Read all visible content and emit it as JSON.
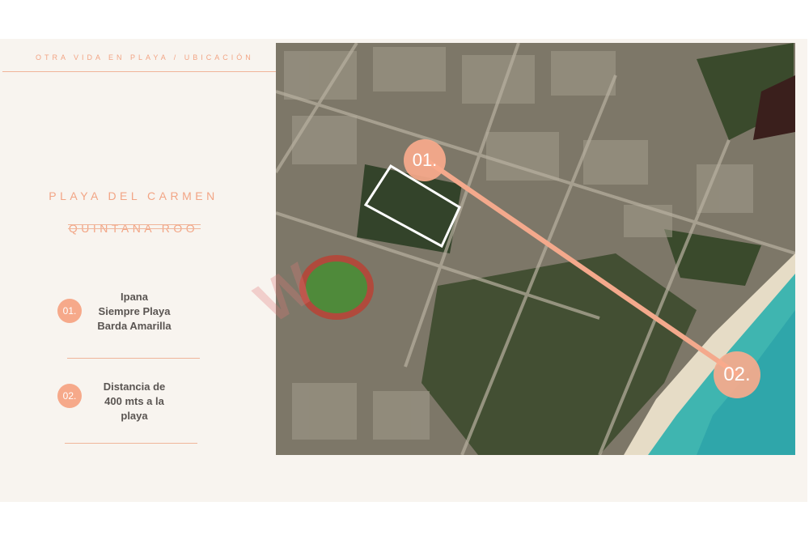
{
  "header": {
    "breadcrumb": "OTRA VIDA EN PLAYA  /  UBICACIÓN"
  },
  "location": {
    "line1": "PLAYA DEL CARMEN",
    "line2": "QUINTANA ROO"
  },
  "items": [
    {
      "number": "01.",
      "lines": [
        "Ipana",
        "Siempre Playa",
        "Barda Amarilla"
      ]
    },
    {
      "number": "02.",
      "lines": [
        "Distancia de",
        "400 mts a la",
        "playa"
      ]
    }
  ],
  "map": {
    "marker_start": "01.",
    "marker_end": "02.",
    "route_color": "#f4a98c",
    "lot_outline_color": "#ffffff",
    "sea_color": "#3fb5b0"
  },
  "watermark": {
    "text": "W"
  },
  "colors": {
    "accent": "#f2a585",
    "background": "#f8f4ef",
    "text": "#5a5552"
  }
}
